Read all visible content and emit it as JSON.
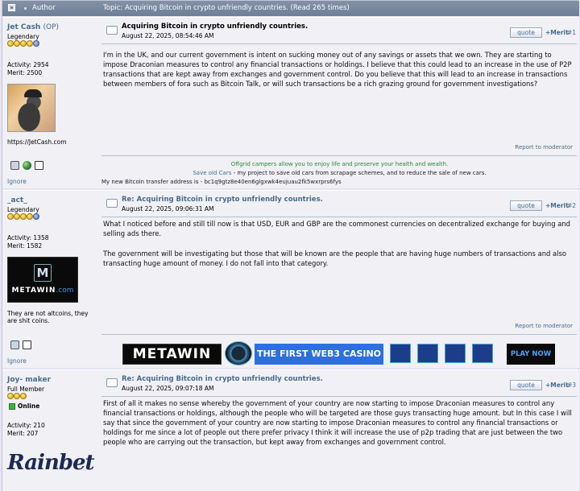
{
  "header": {
    "author_label": "Author",
    "topic_title": "Topic: Acquiring Bitcoin in crypto unfriendly countries.  (Read 265 times)"
  },
  "posts": [
    {
      "username": "Jet Cash",
      "op_tag": "(OP)",
      "rank": "Legendary",
      "activity": "Activity: 2954",
      "merit": "Merit: 2500",
      "website": "https://JetCash.com",
      "ignore": "Ignore",
      "title": "Acquiring Bitcoin in crypto unfriendly countries.",
      "date": "August 22, 2025, 08:54:46 AM",
      "quote": "quote",
      "merit_btn": "+Merit",
      "number": "#1",
      "body": "I'm in the UK, and our current government is intent on sucking money out of any savings or assets that we own. They are starting to impose Draconian measures to control any financial transactions or holdings. I believe that this could lead to an increase in the use of P2P transactions that are kept away from exchanges and government control. Do you believe that this will lead to an increase in transactions between members of fora such as Bitcoin Talk, or will such transactions be a rich grazing ground for government investigations?",
      "report": "Report to moderator",
      "signature": {
        "line1_link": "Offgrid campers",
        "line1_text": " allow you to enjoy life and preserve your health and wealth.",
        "line2_link": "Save old Cars",
        "line2_text": " - my project to save old cars from scrapage schemes, and to reduce the sale of new cars.",
        "line3": "My new Bitcoin transfer address is - bc1q9gtz8e40en6glgxwk4eujuau2fk5wxrprs6fys"
      }
    },
    {
      "username": "_act_",
      "rank": "Legendary",
      "activity": "Activity: 1358",
      "merit": "Merit: 1582",
      "avatar_text": "METAWIN",
      "avatar_com": ".com",
      "personal_text": "They are not altcoins, they are shit coins.",
      "ignore": "Ignore",
      "title": "Re: Acquiring Bitcoin in crypto unfriendly countries.",
      "date": "August 22, 2025, 09:06:31 AM",
      "quote": "quote",
      "merit_btn": "+Merit",
      "number": "#2",
      "body1": "What I noticed before and still till now is that USD, EUR and GBP are the commonest currencies on decentralized exchange for buying and selling ads there.",
      "body2": "The government will be investigating but those that will be known are the people that are having huge numbers of transactions and also transacting huge amount of money. I do not fall into that category.",
      "report": "Report to moderator",
      "banner": {
        "brand": "METAWIN",
        "tagline": "THE FIRST WEB3 CASINO",
        "cta": "PLAY NOW"
      }
    },
    {
      "username": "Joy- maker",
      "rank": "Full Member",
      "online": "Online",
      "activity": "Activity: 210",
      "merit": "Merit: 207",
      "signature_logo": "Rainbet",
      "title": "Re: Acquiring Bitcoin in crypto unfriendly countries.",
      "date": "August 22, 2025, 09:07:18 AM",
      "quote": "quote",
      "merit_btn": "+Merit",
      "number": "#3",
      "body": "First of all it makes no sense whereby the government of your country are now starting to impose Draconian measures to control any financial transactions or holdings, although the people who will be targeted are those guys transacting huge amount. but In this case I will say that since the government of your country are now  starting to impose Draconian measures to control any financial transactions or holdings for me since a lot of people out there prefer privacy I think it will increase the use of p2p trading that are just between the two people who are carrying out the transaction, but kept away from  exchanges and government control."
    }
  ]
}
